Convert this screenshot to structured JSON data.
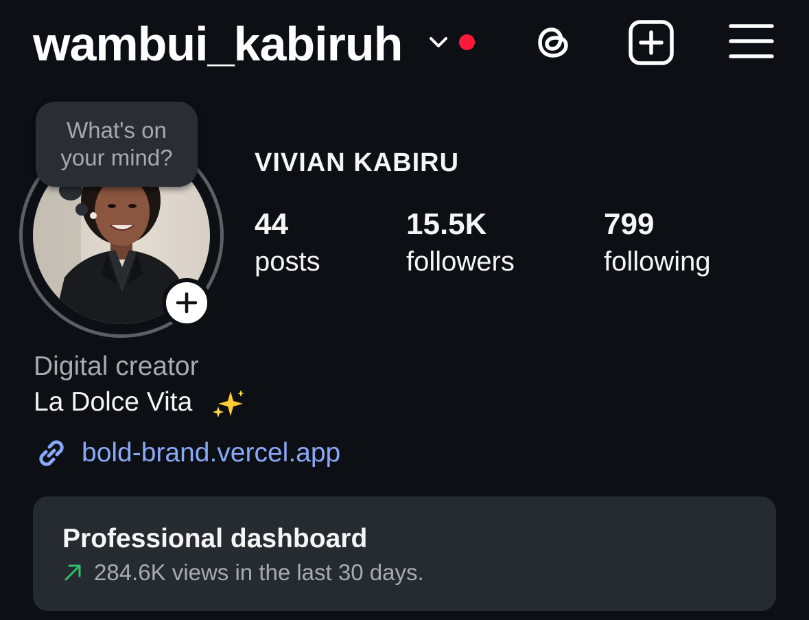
{
  "colors": {
    "background": "#0c1014",
    "notification_dot": "#ff1a3a",
    "link": "#8aa8f8",
    "trend_up": "#2fc36a"
  },
  "header": {
    "username": "wambui_kabiruh",
    "account_switch_icon": "chevron-down-icon",
    "notification_indicator": "red-dot",
    "actions": [
      "threads-icon",
      "create-post-icon",
      "hamburger-menu-icon"
    ]
  },
  "note": {
    "placeholder": "What's on your mind?"
  },
  "profile": {
    "display_name": "VIVIAN KABIRU",
    "avatar_alt": "Profile photo of Vivian Kabiru",
    "add_story_icon": "plus-icon"
  },
  "stats": {
    "posts": {
      "value": "44",
      "label": "posts"
    },
    "followers": {
      "value": "15.5K",
      "label": "followers"
    },
    "following": {
      "value": "799",
      "label": "following"
    }
  },
  "bio": {
    "category": "Digital creator",
    "text": "La Dolce Vita",
    "emoji_icon": "sparkles-icon",
    "link_icon": "link-icon",
    "link": "bold-brand.vercel.app"
  },
  "dashboard": {
    "title": "Professional dashboard",
    "trend_icon": "arrow-up-right-icon",
    "subtitle": "284.6K views in the last 30 days."
  }
}
